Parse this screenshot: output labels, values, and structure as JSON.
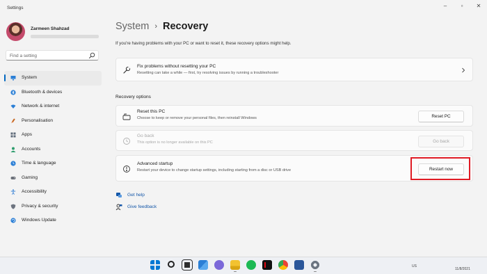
{
  "window": {
    "title": "Settings"
  },
  "profile": {
    "name": "Zarmeen Shahzad"
  },
  "search": {
    "placeholder": "Find a setting"
  },
  "nav": [
    {
      "label": "System",
      "icon": "monitor-icon",
      "active": true
    },
    {
      "label": "Bluetooth & devices",
      "icon": "bluetooth-icon"
    },
    {
      "label": "Network & internet",
      "icon": "wifi-icon"
    },
    {
      "label": "Personalisation",
      "icon": "brush-icon"
    },
    {
      "label": "Apps",
      "icon": "apps-icon"
    },
    {
      "label": "Accounts",
      "icon": "person-icon"
    },
    {
      "label": "Time & language",
      "icon": "globe-clock-icon"
    },
    {
      "label": "Gaming",
      "icon": "gamepad-icon"
    },
    {
      "label": "Accessibility",
      "icon": "accessibility-icon"
    },
    {
      "label": "Privacy & security",
      "icon": "shield-icon"
    },
    {
      "label": "Windows Update",
      "icon": "update-icon"
    }
  ],
  "breadcrumb": {
    "parent": "System",
    "separator": "›",
    "current": "Recovery"
  },
  "intro": "If you're having problems with your PC or want to reset it, these recovery options might help.",
  "fix_card": {
    "title": "Fix problems without resetting your PC",
    "desc": "Resetting can take a while — first, try resolving issues by running a troubleshooter"
  },
  "recovery_section": {
    "label": "Recovery options"
  },
  "options": [
    {
      "title": "Reset this PC",
      "desc": "Choose to keep or remove your personal files, then reinstall Windows",
      "button": "Reset PC",
      "enabled": true,
      "icon": "reset-pc-icon"
    },
    {
      "title": "Go back",
      "desc": "This option is no longer available on this PC",
      "button": "Go back",
      "enabled": false,
      "icon": "history-icon"
    },
    {
      "title": "Advanced startup",
      "desc": "Restart your device to change startup settings, including starting from a disc or USB drive",
      "button": "Restart now",
      "enabled": true,
      "highlighted": true,
      "icon": "advanced-startup-icon"
    }
  ],
  "links": [
    {
      "label": "Get help",
      "icon": "help-icon"
    },
    {
      "label": "Give feedback",
      "icon": "feedback-icon"
    }
  ],
  "taskbar": {
    "apps": [
      "windows-start-icon",
      "search-icon",
      "task-view-icon",
      "widgets-icon",
      "chat-icon",
      "file-explorer-icon",
      "spotify-icon",
      "netflix-icon",
      "chrome-icon",
      "word-icon",
      "settings-icon"
    ],
    "tray": {
      "lang": "US",
      "date": "11/8/2021"
    }
  },
  "colors": {
    "accent": "#0067c0",
    "link": "#1457a8",
    "highlight_border": "#e01b24",
    "background": "#f3f3f3"
  }
}
